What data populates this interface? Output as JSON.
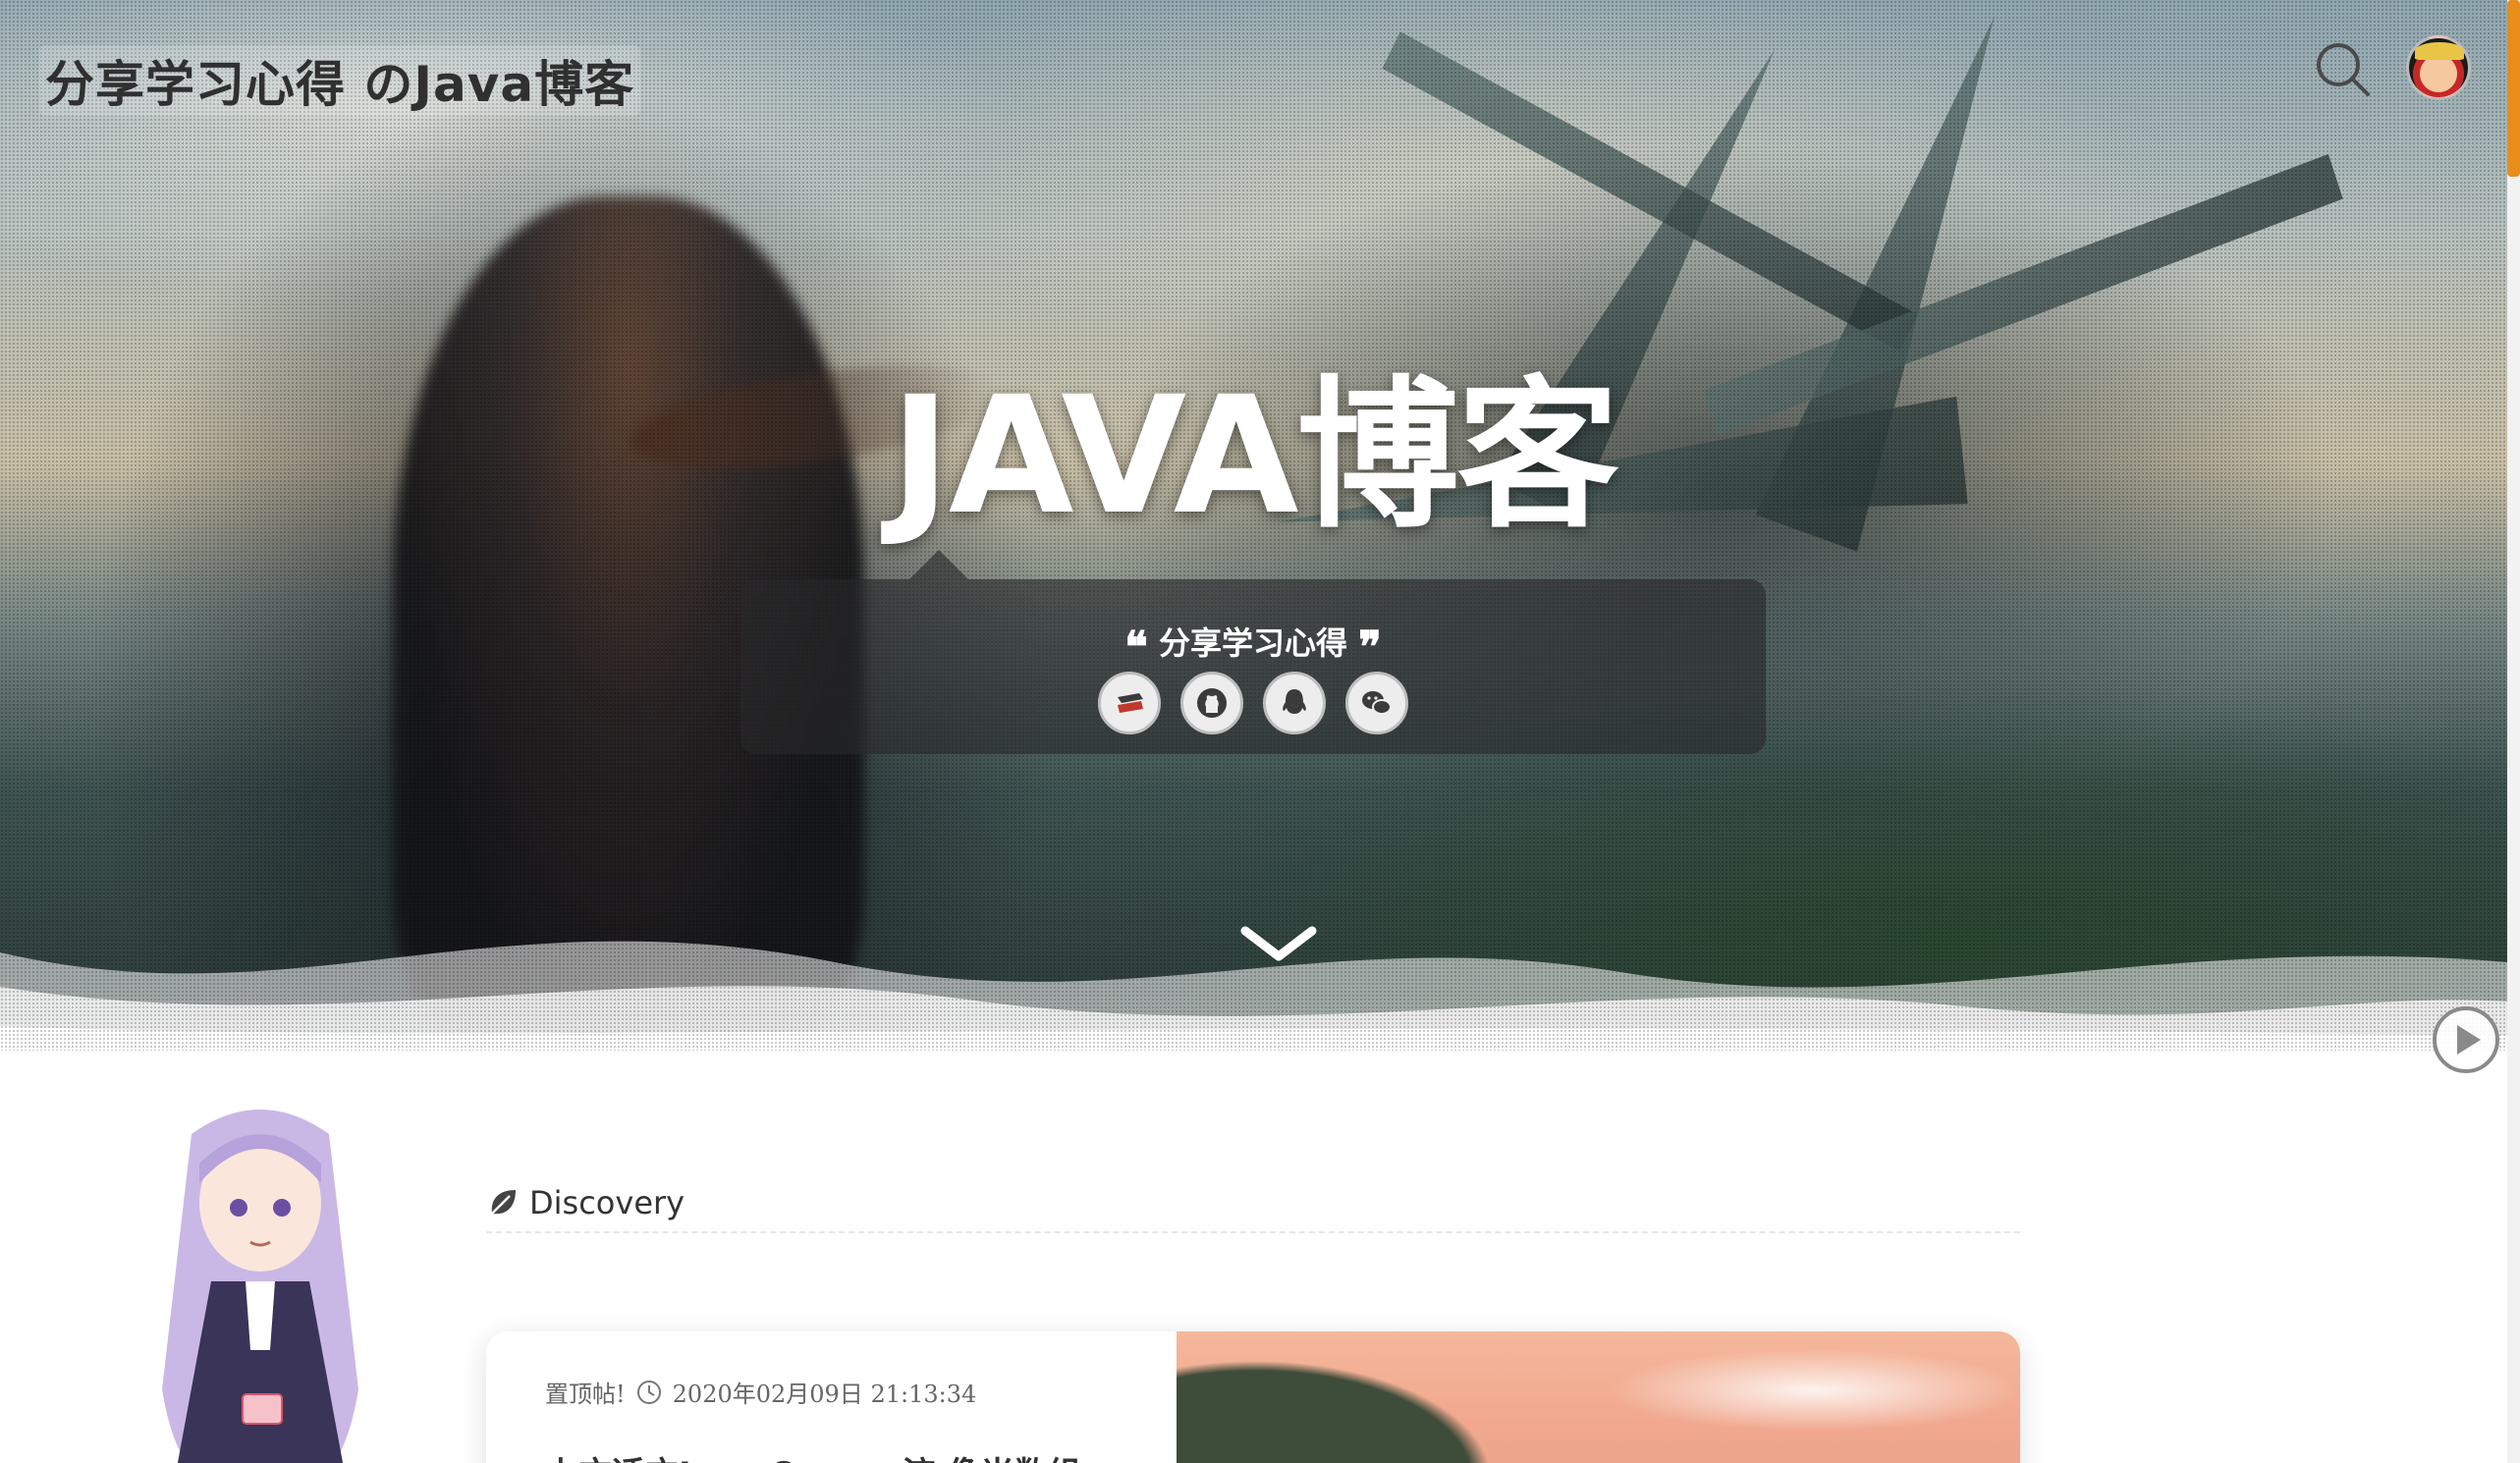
{
  "header": {
    "site_title": "分享学习心得 のJava博客",
    "search_icon": "search-icon",
    "avatar_icon": "avatar"
  },
  "hero": {
    "title": "JAVA博客",
    "motto": "分享学习心得",
    "social_links": [
      {
        "icon": "csdn-icon"
      },
      {
        "icon": "github-icon"
      },
      {
        "icon": "qq-icon"
      },
      {
        "icon": "wechat-icon"
      }
    ],
    "scroll_down_icon": "chevron-down-icon"
  },
  "content": {
    "section_title": "Discovery",
    "section_icon": "leaf-icon",
    "pinned_post": {
      "pin_label": "置顶帖!",
      "date": "2020年02月09日 21:13:34",
      "title": "上方适方Java Queue 流 像当数组"
    }
  },
  "colors": {
    "accent": "#e88c1a",
    "text_dark": "#333333"
  }
}
